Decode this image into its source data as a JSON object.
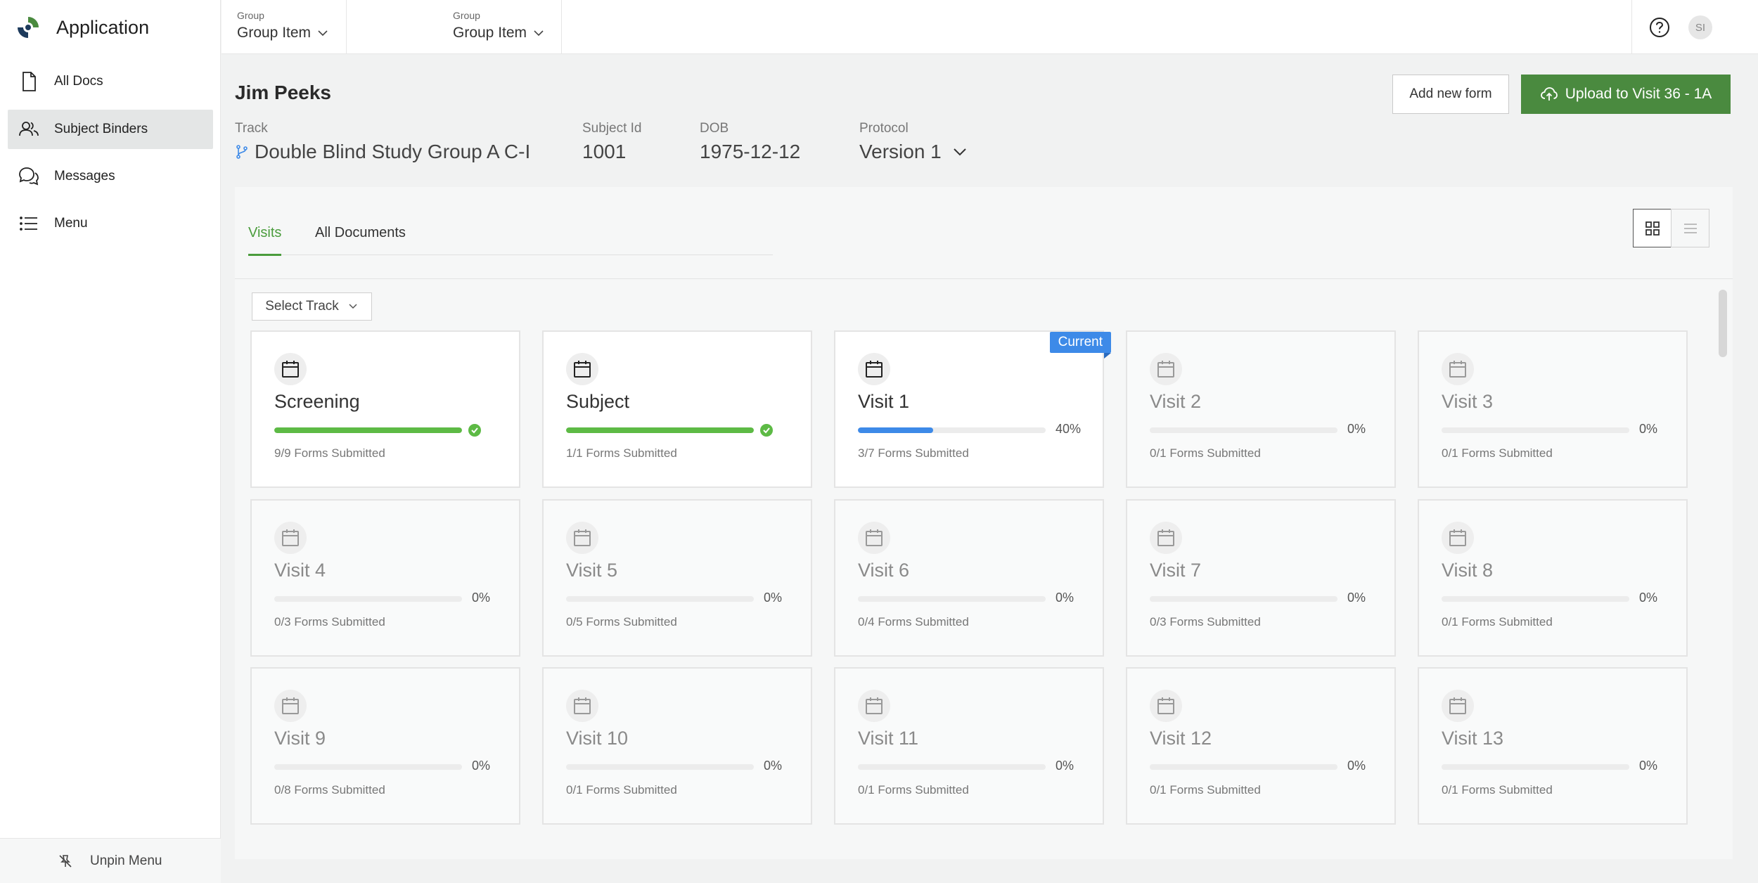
{
  "app": {
    "title": "Application"
  },
  "sidebar": {
    "items": [
      {
        "label": "All Docs",
        "icon": "document-icon"
      },
      {
        "label": "Subject Binders",
        "icon": "users-icon"
      },
      {
        "label": "Messages",
        "icon": "messages-icon"
      },
      {
        "label": "Menu",
        "icon": "list-icon"
      }
    ],
    "unpin_label": "Unpin Menu"
  },
  "topbar": {
    "groups": [
      {
        "label": "Group",
        "value": "Group Item"
      },
      {
        "label": "Group",
        "value": "Group Item"
      }
    ],
    "avatar_initials": "SI"
  },
  "subject": {
    "name": "Jim Peeks",
    "track_label": "Track",
    "track_value": "Double Blind Study Group A C-I",
    "subject_id_label": "Subject Id",
    "subject_id_value": "1001",
    "dob_label": "DOB",
    "dob_value": "1975-12-12",
    "protocol_label": "Protocol",
    "protocol_value": "Version 1"
  },
  "actions": {
    "add_form": "Add new form",
    "upload": "Upload to Visit 36 - 1A"
  },
  "tabs": [
    {
      "label": "Visits",
      "active": true
    },
    {
      "label": "All Documents",
      "active": false
    }
  ],
  "select_track": "Select Track",
  "colors": {
    "accent_green": "#4a8a3f",
    "progress_green": "#5dba45",
    "progress_blue": "#3d8ae8"
  },
  "current_badge": "Current",
  "visits": [
    {
      "title": "Screening",
      "progress": 100,
      "pct_label": "",
      "subtitle": "9/9 Forms Submitted",
      "complete": true,
      "active": true
    },
    {
      "title": "Subject",
      "progress": 100,
      "pct_label": "",
      "subtitle": "1/1 Forms Submitted",
      "complete": true,
      "active": true
    },
    {
      "title": "Visit 1",
      "progress": 40,
      "pct_label": "40%",
      "subtitle": "3/7 Forms Submitted",
      "complete": false,
      "active": true,
      "current": true
    },
    {
      "title": "Visit 2",
      "progress": 0,
      "pct_label": "0%",
      "subtitle": "0/1 Forms Submitted"
    },
    {
      "title": "Visit 3",
      "progress": 0,
      "pct_label": "0%",
      "subtitle": "0/1 Forms Submitted"
    },
    {
      "title": "Visit 4",
      "progress": 0,
      "pct_label": "0%",
      "subtitle": "0/3 Forms Submitted"
    },
    {
      "title": "Visit 5",
      "progress": 0,
      "pct_label": "0%",
      "subtitle": "0/5 Forms Submitted"
    },
    {
      "title": "Visit 6",
      "progress": 0,
      "pct_label": "0%",
      "subtitle": "0/4 Forms Submitted"
    },
    {
      "title": "Visit 7",
      "progress": 0,
      "pct_label": "0%",
      "subtitle": "0/3 Forms Submitted"
    },
    {
      "title": "Visit 8",
      "progress": 0,
      "pct_label": "0%",
      "subtitle": "0/1 Forms Submitted"
    },
    {
      "title": "Visit 9",
      "progress": 0,
      "pct_label": "0%",
      "subtitle": "0/8 Forms Submitted"
    },
    {
      "title": "Visit 10",
      "progress": 0,
      "pct_label": "0%",
      "subtitle": "0/1 Forms Submitted"
    },
    {
      "title": "Visit 11",
      "progress": 0,
      "pct_label": "0%",
      "subtitle": "0/1 Forms Submitted"
    },
    {
      "title": "Visit 12",
      "progress": 0,
      "pct_label": "0%",
      "subtitle": "0/1 Forms Submitted"
    },
    {
      "title": "Visit 13",
      "progress": 0,
      "pct_label": "0%",
      "subtitle": "0/1 Forms Submitted"
    }
  ]
}
